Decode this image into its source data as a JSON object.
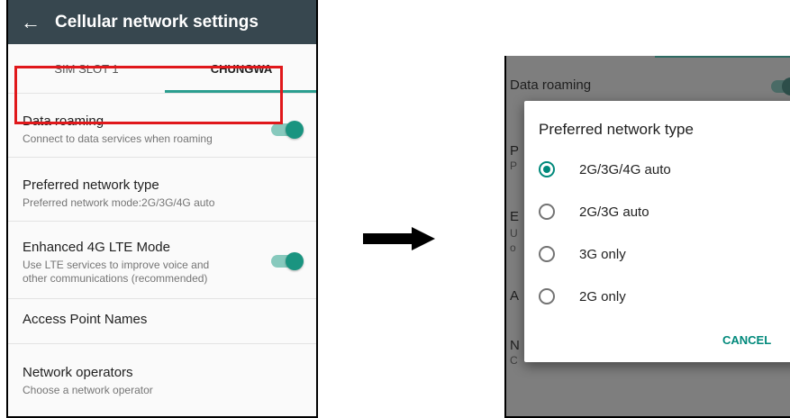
{
  "left_screen": {
    "app_bar": {
      "back_icon": "←",
      "title": "Cellular network settings"
    },
    "tabs": [
      {
        "label": "SIM SLOT 1"
      },
      {
        "label": "CHUNGWA"
      }
    ],
    "rows": {
      "data_roaming": {
        "title": "Data roaming",
        "summary": "Connect to data services when roaming",
        "toggle_on": true
      },
      "preferred_network": {
        "title": "Preferred network type",
        "summary": "Preferred network mode:2G/3G/4G auto"
      },
      "enhanced_lte": {
        "title": "Enhanced 4G LTE Mode",
        "summary_line1": "Use LTE services to improve voice and",
        "summary_line2": "other communications (recommended)",
        "toggle_on": true
      },
      "apn": {
        "title": "Access Point Names"
      },
      "operators": {
        "title": "Network operators",
        "summary": "Choose a network operator"
      }
    },
    "highlight_color": "#e0181b"
  },
  "right_screen": {
    "background_fragments": {
      "data_roaming": "Data roaming",
      "p1": "P",
      "p2": "P",
      "e1": "E",
      "u1": "U",
      "o1": "o",
      "a1": "A",
      "n1": "N",
      "c1": "C"
    },
    "dialog": {
      "title": "Preferred network type",
      "options": [
        {
          "label": "2G/3G/4G auto",
          "selected": true
        },
        {
          "label": "2G/3G auto",
          "selected": false
        },
        {
          "label": "3G only",
          "selected": false
        },
        {
          "label": "2G only",
          "selected": false
        }
      ],
      "cancel_label": "CANCEL"
    },
    "accent_color": "#00897b"
  }
}
